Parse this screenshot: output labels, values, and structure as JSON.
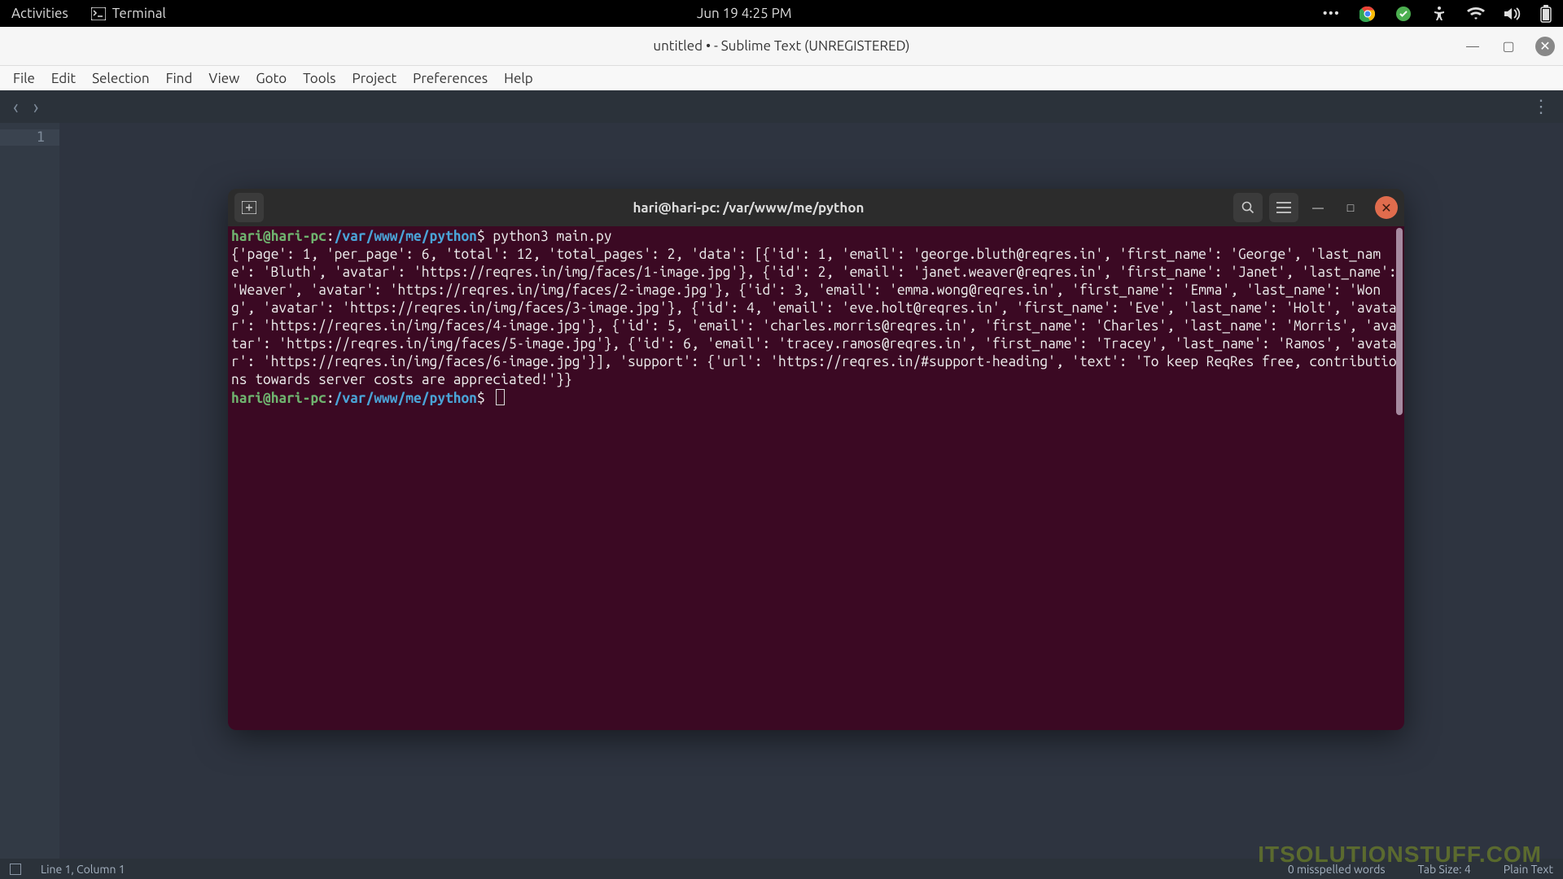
{
  "gnome": {
    "activities": "Activities",
    "app_name": "Terminal",
    "datetime": "Jun 19  4:25 PM"
  },
  "sublime": {
    "title": "untitled • - Sublime Text (UNREGISTERED)",
    "menu": [
      "File",
      "Edit",
      "Selection",
      "Find",
      "View",
      "Goto",
      "Tools",
      "Project",
      "Preferences",
      "Help"
    ],
    "line_number": "1",
    "status_left": "Line 1, Column 1",
    "status_spell": "0 misspelled words",
    "status_tab": "Tab Size: 4",
    "status_syntax": "Plain Text"
  },
  "terminal": {
    "title": "hari@hari-pc: /var/www/me/python",
    "prompt_user": "hari@hari-pc",
    "prompt_path": "/var/www/me/python",
    "command": "python3 main.py",
    "output": "{'page': 1, 'per_page': 6, 'total': 12, 'total_pages': 2, 'data': [{'id': 1, 'email': 'george.bluth@reqres.in', 'first_name': 'George', 'last_name': 'Bluth', 'avatar': 'https://reqres.in/img/faces/1-image.jpg'}, {'id': 2, 'email': 'janet.weaver@reqres.in', 'first_name': 'Janet', 'last_name': 'Weaver', 'avatar': 'https://reqres.in/img/faces/2-image.jpg'}, {'id': 3, 'email': 'emma.wong@reqres.in', 'first_name': 'Emma', 'last_name': 'Wong', 'avatar': 'https://reqres.in/img/faces/3-image.jpg'}, {'id': 4, 'email': 'eve.holt@reqres.in', 'first_name': 'Eve', 'last_name': 'Holt', 'avatar': 'https://reqres.in/img/faces/4-image.jpg'}, {'id': 5, 'email': 'charles.morris@reqres.in', 'first_name': 'Charles', 'last_name': 'Morris', 'avatar': 'https://reqres.in/img/faces/5-image.jpg'}, {'id': 6, 'email': 'tracey.ramos@reqres.in', 'first_name': 'Tracey', 'last_name': 'Ramos', 'avatar': 'https://reqres.in/img/faces/6-image.jpg'}], 'support': {'url': 'https://reqres.in/#support-heading', 'text': 'To keep ReqRes free, contributions towards server costs are appreciated!'}}"
  },
  "watermark": "ITSOLUTIONSTUFF.COM"
}
